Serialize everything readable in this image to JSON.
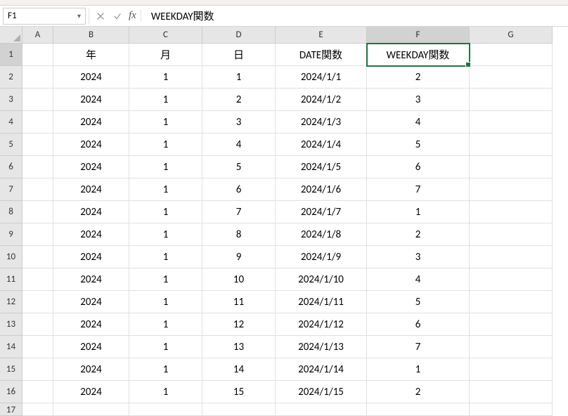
{
  "name_box": {
    "value": "F1"
  },
  "formula_bar": {
    "fx_label": "fx",
    "value": "WEEKDAY関数"
  },
  "columns": [
    {
      "key": "A",
      "label": "A",
      "w": "wA",
      "sel": false
    },
    {
      "key": "B",
      "label": "B",
      "w": "wB",
      "sel": false
    },
    {
      "key": "C",
      "label": "C",
      "w": "wC",
      "sel": false
    },
    {
      "key": "D",
      "label": "D",
      "w": "wD",
      "sel": false
    },
    {
      "key": "E",
      "label": "E",
      "w": "wE",
      "sel": false
    },
    {
      "key": "F",
      "label": "F",
      "w": "wF",
      "sel": true
    },
    {
      "key": "G",
      "label": "G",
      "w": "wG",
      "sel": false
    }
  ],
  "rows": [
    {
      "n": "1",
      "sel": true,
      "cells": {
        "A": "",
        "B": "年",
        "C": "月",
        "D": "日",
        "E": "DATE関数",
        "F": "WEEKDAY関数",
        "G": ""
      },
      "selcol": "F"
    },
    {
      "n": "2",
      "sel": false,
      "cells": {
        "A": "",
        "B": "2024",
        "C": "1",
        "D": "1",
        "E": "2024/1/1",
        "F": "2",
        "G": ""
      }
    },
    {
      "n": "3",
      "sel": false,
      "cells": {
        "A": "",
        "B": "2024",
        "C": "1",
        "D": "2",
        "E": "2024/1/2",
        "F": "3",
        "G": ""
      }
    },
    {
      "n": "4",
      "sel": false,
      "cells": {
        "A": "",
        "B": "2024",
        "C": "1",
        "D": "3",
        "E": "2024/1/3",
        "F": "4",
        "G": ""
      }
    },
    {
      "n": "5",
      "sel": false,
      "cells": {
        "A": "",
        "B": "2024",
        "C": "1",
        "D": "4",
        "E": "2024/1/4",
        "F": "5",
        "G": ""
      }
    },
    {
      "n": "6",
      "sel": false,
      "cells": {
        "A": "",
        "B": "2024",
        "C": "1",
        "D": "5",
        "E": "2024/1/5",
        "F": "6",
        "G": ""
      }
    },
    {
      "n": "7",
      "sel": false,
      "cells": {
        "A": "",
        "B": "2024",
        "C": "1",
        "D": "6",
        "E": "2024/1/6",
        "F": "7",
        "G": ""
      }
    },
    {
      "n": "8",
      "sel": false,
      "cells": {
        "A": "",
        "B": "2024",
        "C": "1",
        "D": "7",
        "E": "2024/1/7",
        "F": "1",
        "G": ""
      }
    },
    {
      "n": "9",
      "sel": false,
      "cells": {
        "A": "",
        "B": "2024",
        "C": "1",
        "D": "8",
        "E": "2024/1/8",
        "F": "2",
        "G": ""
      }
    },
    {
      "n": "10",
      "sel": false,
      "cells": {
        "A": "",
        "B": "2024",
        "C": "1",
        "D": "9",
        "E": "2024/1/9",
        "F": "3",
        "G": ""
      }
    },
    {
      "n": "11",
      "sel": false,
      "cells": {
        "A": "",
        "B": "2024",
        "C": "1",
        "D": "10",
        "E": "2024/1/10",
        "F": "4",
        "G": ""
      }
    },
    {
      "n": "12",
      "sel": false,
      "cells": {
        "A": "",
        "B": "2024",
        "C": "1",
        "D": "11",
        "E": "2024/1/11",
        "F": "5",
        "G": ""
      }
    },
    {
      "n": "13",
      "sel": false,
      "cells": {
        "A": "",
        "B": "2024",
        "C": "1",
        "D": "12",
        "E": "2024/1/12",
        "F": "6",
        "G": ""
      }
    },
    {
      "n": "14",
      "sel": false,
      "cells": {
        "A": "",
        "B": "2024",
        "C": "1",
        "D": "13",
        "E": "2024/1/13",
        "F": "7",
        "G": ""
      }
    },
    {
      "n": "15",
      "sel": false,
      "cells": {
        "A": "",
        "B": "2024",
        "C": "1",
        "D": "14",
        "E": "2024/1/14",
        "F": "1",
        "G": ""
      }
    },
    {
      "n": "16",
      "sel": false,
      "cells": {
        "A": "",
        "B": "2024",
        "C": "1",
        "D": "15",
        "E": "2024/1/15",
        "F": "2",
        "G": ""
      }
    },
    {
      "n": "17",
      "sel": false,
      "cells": {
        "A": "",
        "B": "",
        "C": "",
        "D": "",
        "E": "",
        "F": "",
        "G": ""
      },
      "partial": true
    }
  ]
}
